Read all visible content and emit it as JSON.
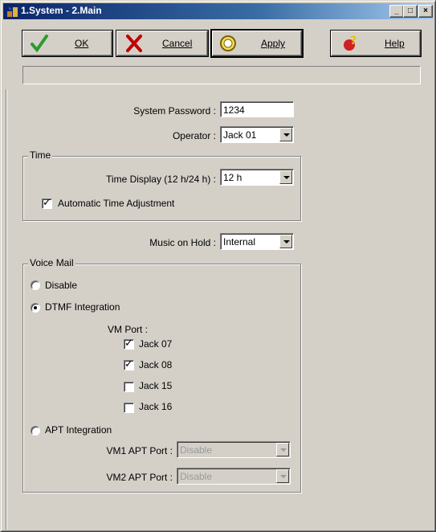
{
  "window": {
    "title": "1.System - 2.Main",
    "controls": {
      "minimize": "_",
      "maximize": "□",
      "close": "×"
    }
  },
  "toolbar": {
    "ok_label": "OK",
    "cancel_label": "Cancel",
    "apply_label": "Apply",
    "help_label": "Help"
  },
  "status": {
    "text": ""
  },
  "system": {
    "password_label": "System Password :",
    "password_value": "1234",
    "operator_label": "Operator :",
    "operator_value": "Jack 01"
  },
  "time": {
    "group_label": "Time",
    "display_label": "Time Display (12 h/24 h) :",
    "display_value": "12 h",
    "auto_adjust_label": "Automatic Time Adjustment",
    "auto_adjust_checked": true
  },
  "music": {
    "label": "Music on Hold :",
    "value": "Internal"
  },
  "voicemail": {
    "group_label": "Voice Mail",
    "disable_label": "Disable",
    "dtmf_label": "DTMF Integration",
    "selected": "dtmf",
    "vm_port_label": "VM Port :",
    "ports": [
      {
        "label": "Jack 07",
        "checked": true
      },
      {
        "label": "Jack 08",
        "checked": true
      },
      {
        "label": "Jack 15",
        "checked": false
      },
      {
        "label": "Jack 16",
        "checked": false
      }
    ],
    "apt_label": "APT Integration",
    "vm1_label": "VM1 APT Port :",
    "vm1_value": "Disable",
    "vm2_label": "VM2 APT Port :",
    "vm2_value": "Disable"
  },
  "colors": {
    "face": "#d4d0c8",
    "title_start": "#0a246a",
    "title_end": "#a6caf0",
    "ok_check": "#2e9a2e",
    "cancel_x": "#c00000"
  }
}
